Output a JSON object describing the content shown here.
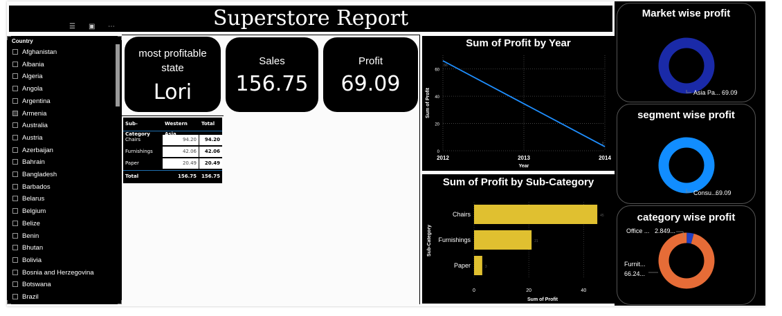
{
  "report": {
    "title": "Superstore Report"
  },
  "slicer": {
    "header": "Country",
    "items": [
      {
        "label": "Afghanistan",
        "checked": false
      },
      {
        "label": "Albania",
        "checked": false
      },
      {
        "label": "Algeria",
        "checked": false
      },
      {
        "label": "Angola",
        "checked": false
      },
      {
        "label": "Argentina",
        "checked": false
      },
      {
        "label": "Armenia",
        "checked": true
      },
      {
        "label": "Australia",
        "checked": false
      },
      {
        "label": "Austria",
        "checked": false
      },
      {
        "label": "Azerbaijan",
        "checked": false
      },
      {
        "label": "Bahrain",
        "checked": false
      },
      {
        "label": "Bangladesh",
        "checked": false
      },
      {
        "label": "Barbados",
        "checked": false
      },
      {
        "label": "Belarus",
        "checked": false
      },
      {
        "label": "Belgium",
        "checked": false
      },
      {
        "label": "Belize",
        "checked": false
      },
      {
        "label": "Benin",
        "checked": false
      },
      {
        "label": "Bhutan",
        "checked": false
      },
      {
        "label": "Bolivia",
        "checked": false
      },
      {
        "label": "Bosnia and Herzegovina",
        "checked": false
      },
      {
        "label": "Botswana",
        "checked": false
      },
      {
        "label": "Brazil",
        "checked": false
      }
    ]
  },
  "cards": {
    "state": {
      "label_line1": "most profitable",
      "label_line2": "state",
      "value": "Lori"
    },
    "sales": {
      "label": "Sales",
      "value": "156.75"
    },
    "profit": {
      "label": "Profit",
      "value": "69.09"
    }
  },
  "matrix": {
    "headers": [
      "Sub-Category",
      "Western Asia",
      "Total"
    ],
    "rows": [
      {
        "label": "Chairs",
        "value": "94.20",
        "total": "94.20"
      },
      {
        "label": "Furnishings",
        "value": "42.06",
        "total": "42.06"
      },
      {
        "label": "Paper",
        "value": "20.49",
        "total": "20.49"
      }
    ],
    "total_row": {
      "label": "Total",
      "value": "156.75",
      "total": "156.75"
    }
  },
  "chart_data": [
    {
      "type": "line",
      "title": "Sum of Profit by Year",
      "xlabel": "Year",
      "ylabel": "Sum of Profit",
      "x": [
        2012,
        2014
      ],
      "xticks": [
        "2012",
        "2013",
        "2014"
      ],
      "yticks": [
        "0",
        "20",
        "40",
        "60"
      ],
      "ylim": [
        0,
        70
      ],
      "series": [
        {
          "values": [
            66,
            3
          ],
          "color": "#1f8fff"
        }
      ],
      "data_labels": [
        "66",
        "3"
      ],
      "grid": true
    },
    {
      "type": "bar",
      "orientation": "horizontal",
      "title": "Sum of Profit by Sub-Category",
      "xlabel": "Sum of Profit",
      "ylabel": "Sub-Category",
      "categories": [
        "Chairs",
        "Furnishings",
        "Paper"
      ],
      "values": [
        45,
        21,
        3
      ],
      "data_labels": [
        "45",
        "21",
        "3"
      ],
      "xticks": [
        "0",
        "20",
        "40"
      ],
      "xlim": [
        0,
        48
      ],
      "color": "#e0c030"
    },
    {
      "type": "pie",
      "title": "Market wise profit",
      "labels": [
        "Asia Pa..."
      ],
      "values": [
        69.09
      ],
      "data_labels": [
        "69.09"
      ],
      "colors": [
        "#1a2aa8"
      ]
    },
    {
      "type": "pie",
      "title": "segment wise profit",
      "labels": [
        "Consu..."
      ],
      "values": [
        69.09
      ],
      "data_labels": [
        "69.09"
      ],
      "colors": [
        "#118dff"
      ]
    },
    {
      "type": "pie",
      "title": "category wise profit",
      "labels": [
        "Office ...",
        "Furnit..."
      ],
      "values": [
        2.849,
        66.24
      ],
      "data_labels": [
        "2.849...",
        "66.24..."
      ],
      "colors": [
        "#1f3fc0",
        "#e66c37"
      ]
    }
  ]
}
